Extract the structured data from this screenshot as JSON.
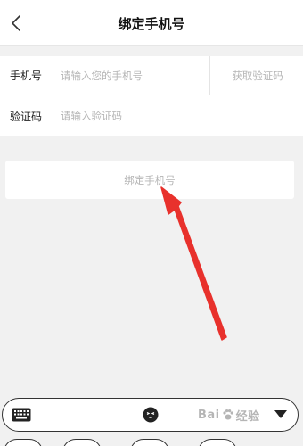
{
  "header": {
    "back_icon": "chevron-left-icon",
    "title": "绑定手机号"
  },
  "form": {
    "phone": {
      "label": "手机号",
      "placeholder": "请输入您的手机号",
      "value": ""
    },
    "code": {
      "label": "验证码",
      "placeholder": "请输入验证码",
      "value": ""
    },
    "get_code_label": "获取验证码"
  },
  "bind_button": {
    "label": "绑定手机号"
  },
  "annotation": {
    "arrow_color": "#e8312c"
  },
  "keyboard_bar": {
    "keyboard_icon": "keyboard-icon",
    "emoji_icon": "emoji-icon",
    "collapse_icon": "triangle-down-icon"
  },
  "watermark": {
    "text_left": "Bai",
    "text_right": "经验"
  },
  "colors": {
    "background": "#f1f1f1",
    "panel": "#ffffff",
    "placeholder": "#b5b5b5",
    "text": "#222222"
  }
}
